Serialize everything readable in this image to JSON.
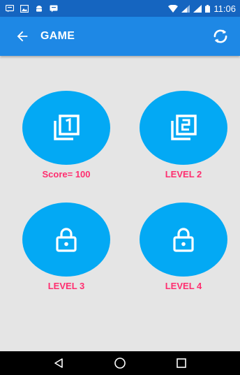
{
  "status_bar": {
    "time": "11:06",
    "icons": [
      "notification-icon",
      "image-icon",
      "android-icon",
      "message-icon",
      "wifi-icon",
      "signal-icon",
      "battery-icon"
    ]
  },
  "app_bar": {
    "title": "GAME",
    "back_icon": "arrow-back-icon",
    "refresh_icon": "refresh-icon"
  },
  "levels": [
    {
      "label": "Score= 100",
      "icon": "level-1-icon",
      "state": "unlocked"
    },
    {
      "label": "LEVEL 2",
      "icon": "level-2-icon",
      "state": "unlocked"
    },
    {
      "label": "LEVEL 3",
      "icon": "lock-icon",
      "state": "locked"
    },
    {
      "label": "LEVEL 4",
      "icon": "lock-icon",
      "state": "locked"
    }
  ],
  "colors": {
    "status_bar": "#1565c0",
    "app_bar": "#1e88e5",
    "tile": "#03a9f4",
    "label": "#ff2d6f",
    "background": "#e5e5e5"
  },
  "nav_bar": {
    "icons": [
      "back-triangle-icon",
      "home-circle-icon",
      "recents-square-icon"
    ]
  }
}
